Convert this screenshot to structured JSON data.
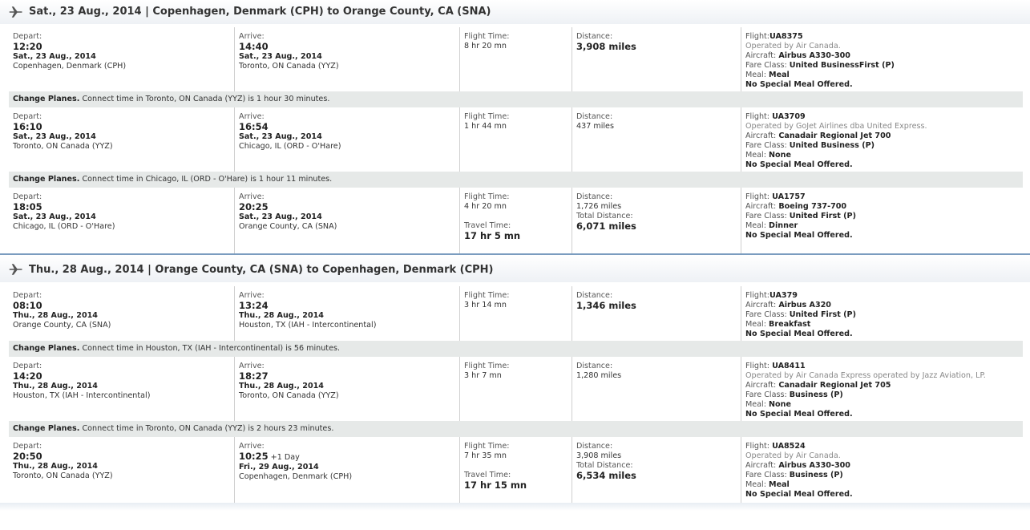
{
  "trips": [
    {
      "header": "Sat., 23 Aug., 2014 | Copenhagen, Denmark (CPH) to Orange County, CA (SNA)",
      "segments": [
        {
          "depart_label": "Depart:",
          "depart_time": "12:20",
          "depart_date": "Sat., 23 Aug., 2014",
          "depart_city": "Copenhagen, Denmark (CPH)",
          "arrive_label": "Arrive:",
          "arrive_time": "14:40",
          "arrive_extra": "",
          "arrive_date": "Sat., 23 Aug., 2014",
          "arrive_city": "Toronto, ON Canada (YYZ)",
          "flight_time_label": "Flight Time:",
          "flight_time": "8 hr 20 mn",
          "distance_label": "Distance:",
          "distance": "3,908 miles",
          "flight_label": "Flight:",
          "flight": "UA8375",
          "operated_by": "Operated by Air Canada.",
          "aircraft_label": "Aircraft:",
          "aircraft": "Airbus A330-300",
          "fare_label": "Fare Class:",
          "fare": "United BusinessFirst (P)",
          "meal_label": "Meal:",
          "meal": "Meal",
          "special_meal": "No Special Meal Offered."
        },
        {
          "depart_label": "Depart:",
          "depart_time": "16:10",
          "depart_date": "Sat., 23 Aug., 2014",
          "depart_city": "Toronto, ON Canada (YYZ)",
          "arrive_label": "Arrive:",
          "arrive_time": "16:54",
          "arrive_extra": "",
          "arrive_date": "Sat., 23 Aug., 2014",
          "arrive_city": "Chicago, IL (ORD - O'Hare)",
          "flight_time_label": "Flight Time:",
          "flight_time": "1 hr 44 mn",
          "distance_label": "Distance:",
          "distance": "437 miles",
          "flight_label": "Flight:",
          "flight": "UA3709",
          "operated_by": "Operated by GoJet Airlines dba United Express.",
          "aircraft_label": "Aircraft:",
          "aircraft": "Canadair Regional Jet 700",
          "fare_label": "Fare Class:",
          "fare": "United Business (P)",
          "meal_label": "Meal:",
          "meal": "None",
          "special_meal": "No Special Meal Offered."
        },
        {
          "depart_label": "Depart:",
          "depart_time": "18:05",
          "depart_date": "Sat., 23 Aug., 2014",
          "depart_city": "Chicago, IL (ORD - O'Hare)",
          "arrive_label": "Arrive:",
          "arrive_time": "20:25",
          "arrive_extra": "",
          "arrive_date": "Sat., 23 Aug., 2014",
          "arrive_city": "Orange County, CA (SNA)",
          "flight_time_label": "Flight Time:",
          "flight_time": "4 hr 20 mn",
          "travel_time_label": "Travel Time:",
          "travel_time": "17 hr 5 mn",
          "distance_label": "Distance:",
          "distance": "1,726 miles",
          "total_distance_label": "Total Distance:",
          "total_distance": "6,071 miles",
          "flight_label": "Flight:",
          "flight": "UA1757",
          "operated_by": "",
          "aircraft_label": "Aircraft:",
          "aircraft": "Boeing 737-700",
          "fare_label": "Fare Class:",
          "fare": "United First (P)",
          "meal_label": "Meal:",
          "meal": "Dinner",
          "special_meal": "No Special Meal Offered."
        }
      ],
      "connections": [
        {
          "label": "Change Planes.",
          "text": "Connect time in Toronto, ON Canada (YYZ) is 1 hour 30 minutes."
        },
        {
          "label": "Change Planes.",
          "text": "Connect time in Chicago, IL (ORD - O'Hare) is 1 hour 11 minutes."
        }
      ]
    },
    {
      "header": "Thu., 28 Aug., 2014 | Orange County, CA (SNA) to Copenhagen, Denmark (CPH)",
      "segments": [
        {
          "depart_label": "Depart:",
          "depart_time": "08:10",
          "depart_date": "Thu., 28 Aug., 2014",
          "depart_city": "Orange County, CA (SNA)",
          "arrive_label": "Arrive:",
          "arrive_time": "13:24",
          "arrive_extra": "",
          "arrive_date": "Thu., 28 Aug., 2014",
          "arrive_city": "Houston, TX (IAH - Intercontinental)",
          "flight_time_label": "Flight Time:",
          "flight_time": "3 hr 14 mn",
          "distance_label": "Distance:",
          "distance": "1,346 miles",
          "flight_label": "Flight:",
          "flight": "UA379",
          "operated_by": "",
          "aircraft_label": "Aircraft:",
          "aircraft": "Airbus A320",
          "fare_label": "Fare Class:",
          "fare": "United First (P)",
          "meal_label": "Meal:",
          "meal": "Breakfast",
          "special_meal": "No Special Meal Offered."
        },
        {
          "depart_label": "Depart:",
          "depart_time": "14:20",
          "depart_date": "Thu., 28 Aug., 2014",
          "depart_city": "Houston, TX (IAH - Intercontinental)",
          "arrive_label": "Arrive:",
          "arrive_time": "18:27",
          "arrive_extra": "",
          "arrive_date": "Thu., 28 Aug., 2014",
          "arrive_city": "Toronto, ON Canada (YYZ)",
          "flight_time_label": "Flight Time:",
          "flight_time": "3 hr 7 mn",
          "distance_label": "Distance:",
          "distance": "1,280 miles",
          "flight_label": "Flight:",
          "flight": "UA8411",
          "operated_by": "Operated by Air Canada Express operated by Jazz Aviation, LP.",
          "aircraft_label": "Aircraft:",
          "aircraft": "Canadair Regional Jet 705",
          "fare_label": "Fare Class:",
          "fare": "Business (P)",
          "meal_label": "Meal:",
          "meal": "None",
          "special_meal": "No Special Meal Offered."
        },
        {
          "depart_label": "Depart:",
          "depart_time": "20:50",
          "depart_date": "Thu., 28 Aug., 2014",
          "depart_city": "Toronto, ON Canada (YYZ)",
          "arrive_label": "Arrive:",
          "arrive_time": "10:25",
          "arrive_extra": "+1 Day",
          "arrive_date": "Fri., 29 Aug., 2014",
          "arrive_city": "Copenhagen, Denmark (CPH)",
          "flight_time_label": "Flight Time:",
          "flight_time": "7 hr 35 mn",
          "travel_time_label": "Travel Time:",
          "travel_time": "17 hr 15 mn",
          "distance_label": "Distance:",
          "distance": "3,908 miles",
          "total_distance_label": "Total Distance:",
          "total_distance": "6,534 miles",
          "flight_label": "Flight:",
          "flight": "UA8524",
          "operated_by": "Operated by Air Canada.",
          "aircraft_label": "Aircraft:",
          "aircraft": "Airbus A330-300",
          "fare_label": "Fare Class:",
          "fare": "Business (P)",
          "meal_label": "Meal:",
          "meal": "Meal",
          "special_meal": "No Special Meal Offered."
        }
      ],
      "connections": [
        {
          "label": "Change Planes.",
          "text": "Connect time in Houston, TX (IAH - Intercontinental) is 56 minutes."
        },
        {
          "label": "Change Planes.",
          "text": "Connect time in Toronto, ON Canada (YYZ) is 2 hours 23 minutes."
        }
      ]
    }
  ]
}
